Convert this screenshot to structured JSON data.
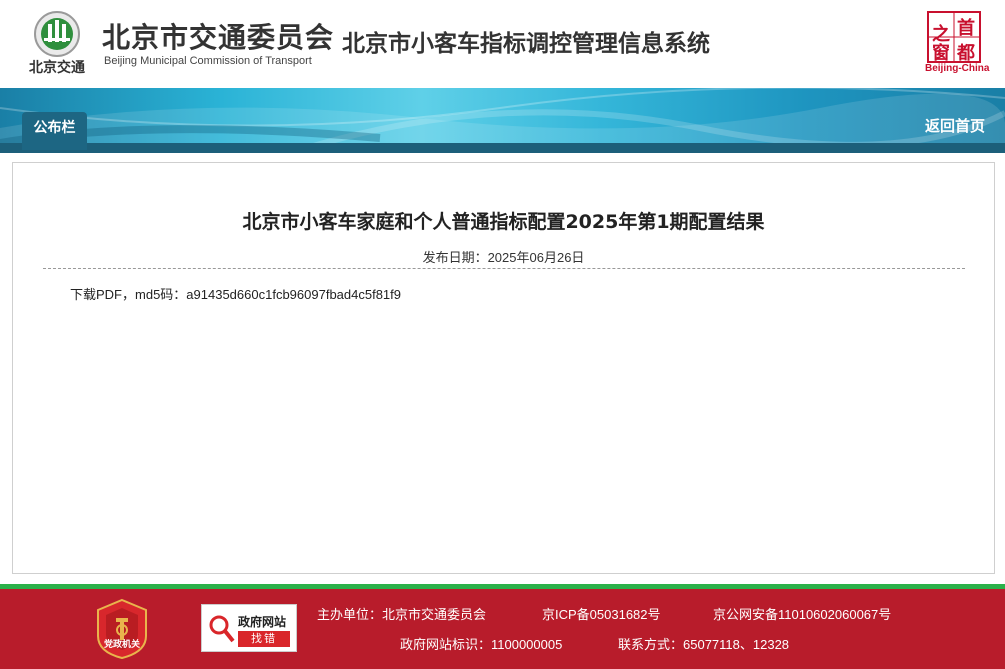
{
  "header": {
    "org_cn": "北京市交通委员会",
    "org_en": "Beijing Municipal Commission of Transport",
    "logo_text": "北京交通",
    "system_title": "北京市小客车指标调控管理信息系统",
    "capital_logo_chars": [
      "首",
      "都",
      "之",
      "窗"
    ],
    "capital_en": "Beijing-China"
  },
  "nav": {
    "tab_label": "公布栏",
    "back_home": "返回首页"
  },
  "article": {
    "title": "北京市小客车家庭和个人普通指标配置2025年第1期配置结果",
    "date_label": "发布日期：2025年06月26日",
    "download_link": "下载PDF",
    "md5_text": "，md5码：a91435d660c1fcb96097fbad4c5f81f9"
  },
  "footer": {
    "badge_text": "党政机关",
    "gov_box_top": "政府网站",
    "gov_box_bottom": "找错",
    "sponsor": "主办单位：北京市交通委员会",
    "icp": "京ICP备05031682号",
    "police": "京公网安备11010602060067号",
    "site_id": "政府网站标识：1100000005",
    "contact": "联系方式：65077118、12328"
  },
  "colors": {
    "banner_primary": "#2ab3d6",
    "tab_bg": "#1d6683",
    "footer_bg": "#b81c2b",
    "footer_stripe": "#2bb14a",
    "capital_red": "#c8102e"
  }
}
